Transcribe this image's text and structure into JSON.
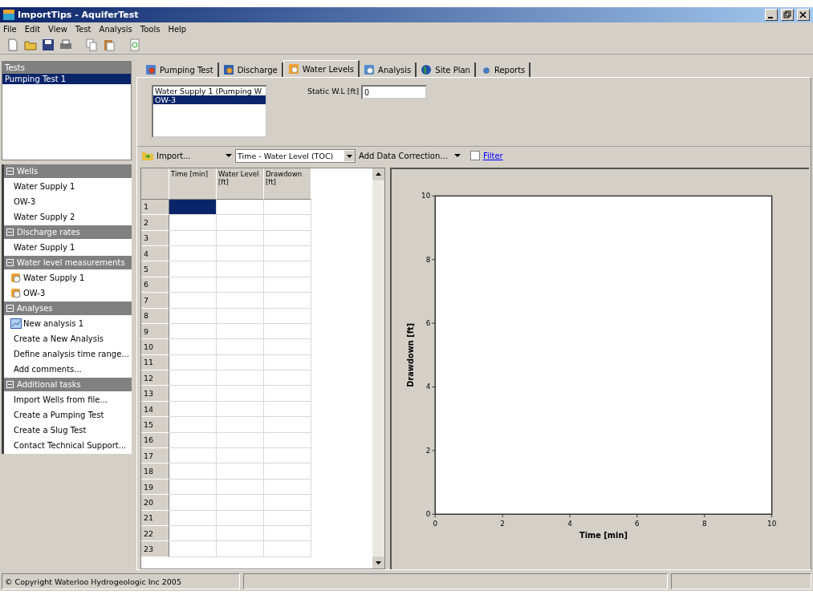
{
  "window": {
    "title": "ImportTips - AquiferTest"
  },
  "menu": [
    "File",
    "Edit",
    "View",
    "Test",
    "Analysis",
    "Tools",
    "Help"
  ],
  "toolbar": [
    {
      "kind": "new"
    },
    {
      "kind": "open"
    },
    {
      "kind": "save"
    },
    {
      "kind": "print"
    },
    {
      "kind": "copy"
    },
    {
      "kind": "paste"
    },
    {
      "kind": "refresh"
    }
  ],
  "tests": {
    "title": "Tests",
    "items": [
      {
        "label": "Pumping Test 1",
        "selected": true
      }
    ]
  },
  "task_sections": [
    {
      "title": "Wells",
      "items": [
        {
          "label": "Water Supply 1",
          "kind": "plain"
        },
        {
          "label": "OW-3",
          "kind": "plain"
        },
        {
          "label": "Water Supply 2",
          "kind": "plain"
        }
      ]
    },
    {
      "title": "Discharge rates",
      "items": [
        {
          "label": "Water Supply 1",
          "kind": "plain"
        }
      ]
    },
    {
      "title": "Water level measurements",
      "items": [
        {
          "label": "Water Supply 1",
          "kind": "measurement"
        },
        {
          "label": "OW-3",
          "kind": "measurement"
        }
      ]
    },
    {
      "title": "Analyses",
      "items": [
        {
          "label": "New analysis 1",
          "kind": "analysis"
        },
        {
          "label": "Create a New Analysis",
          "kind": "plain"
        },
        {
          "label": "Define analysis time range...",
          "kind": "plain"
        },
        {
          "label": "Add comments...",
          "kind": "plain"
        }
      ]
    },
    {
      "title": "Additional tasks",
      "items": [
        {
          "label": "Import Wells from file...",
          "kind": "plain"
        },
        {
          "label": "Create a Pumping Test",
          "kind": "plain"
        },
        {
          "label": "Create a Slug Test",
          "kind": "plain"
        },
        {
          "label": "Contact Technical Support...",
          "kind": "plain"
        }
      ]
    }
  ],
  "tabs": [
    {
      "label": "Pumping Test",
      "kind": "pumping",
      "selected": false
    },
    {
      "label": "Discharge",
      "kind": "discharge",
      "selected": false
    },
    {
      "label": "Water Levels",
      "kind": "water",
      "selected": true
    },
    {
      "label": "Analysis",
      "kind": "analysis",
      "selected": false
    },
    {
      "label": "Site Plan",
      "kind": "globe",
      "selected": false
    },
    {
      "label": "Reports",
      "kind": "reports",
      "selected": false
    }
  ],
  "wells_list": [
    {
      "label": "Water Supply 1 (Pumping W",
      "selected": false
    },
    {
      "label": "OW-3",
      "selected": true
    }
  ],
  "static_wl": {
    "label": "Static W.L [ft]",
    "value": "0"
  },
  "data_toolbar": {
    "import": "Import...",
    "data_type": "Time - Water Level (TOC)",
    "correction": "Add Data Correction...",
    "filter": {
      "label": "Filter",
      "checked": false
    }
  },
  "grid": {
    "columns": [
      "Time [min]",
      "Water Level [ft]",
      "Drawdown [ft]"
    ],
    "rows": [
      {
        "label": "1",
        "selected": true
      },
      {
        "label": "2",
        "selected": false
      },
      {
        "label": "3",
        "selected": false
      },
      {
        "label": "4",
        "selected": false
      },
      {
        "label": "5",
        "selected": false
      },
      {
        "label": "6",
        "selected": false
      },
      {
        "label": "7",
        "selected": false
      },
      {
        "label": "8",
        "selected": false
      },
      {
        "label": "9",
        "selected": false
      },
      {
        "label": "10",
        "selected": false
      },
      {
        "label": "11",
        "selected": false
      },
      {
        "label": "12",
        "selected": false
      },
      {
        "label": "13",
        "selected": false
      },
      {
        "label": "14",
        "selected": false
      },
      {
        "label": "15",
        "selected": false
      },
      {
        "label": "16",
        "selected": false
      },
      {
        "label": "17",
        "selected": false
      },
      {
        "label": "18",
        "selected": false
      },
      {
        "label": "19",
        "selected": false
      },
      {
        "label": "20",
        "selected": false
      },
      {
        "label": "21",
        "selected": false
      },
      {
        "label": "22",
        "selected": false
      },
      {
        "label": "23",
        "selected": false
      }
    ]
  },
  "chart": {
    "chart_data": {
      "type": "line",
      "xlabel": "Time [min]",
      "ylabel": "Drawdown [ft]",
      "xlim": [
        0,
        10
      ],
      "ylim": [
        0,
        10
      ],
      "xticks": [
        0,
        2,
        4,
        6,
        8,
        10
      ],
      "yticks": [
        0,
        2,
        4,
        6,
        8,
        10
      ]
    }
  },
  "status_bar": [
    "© Copyright Waterloo Hydrogeologic Inc 2005"
  ]
}
